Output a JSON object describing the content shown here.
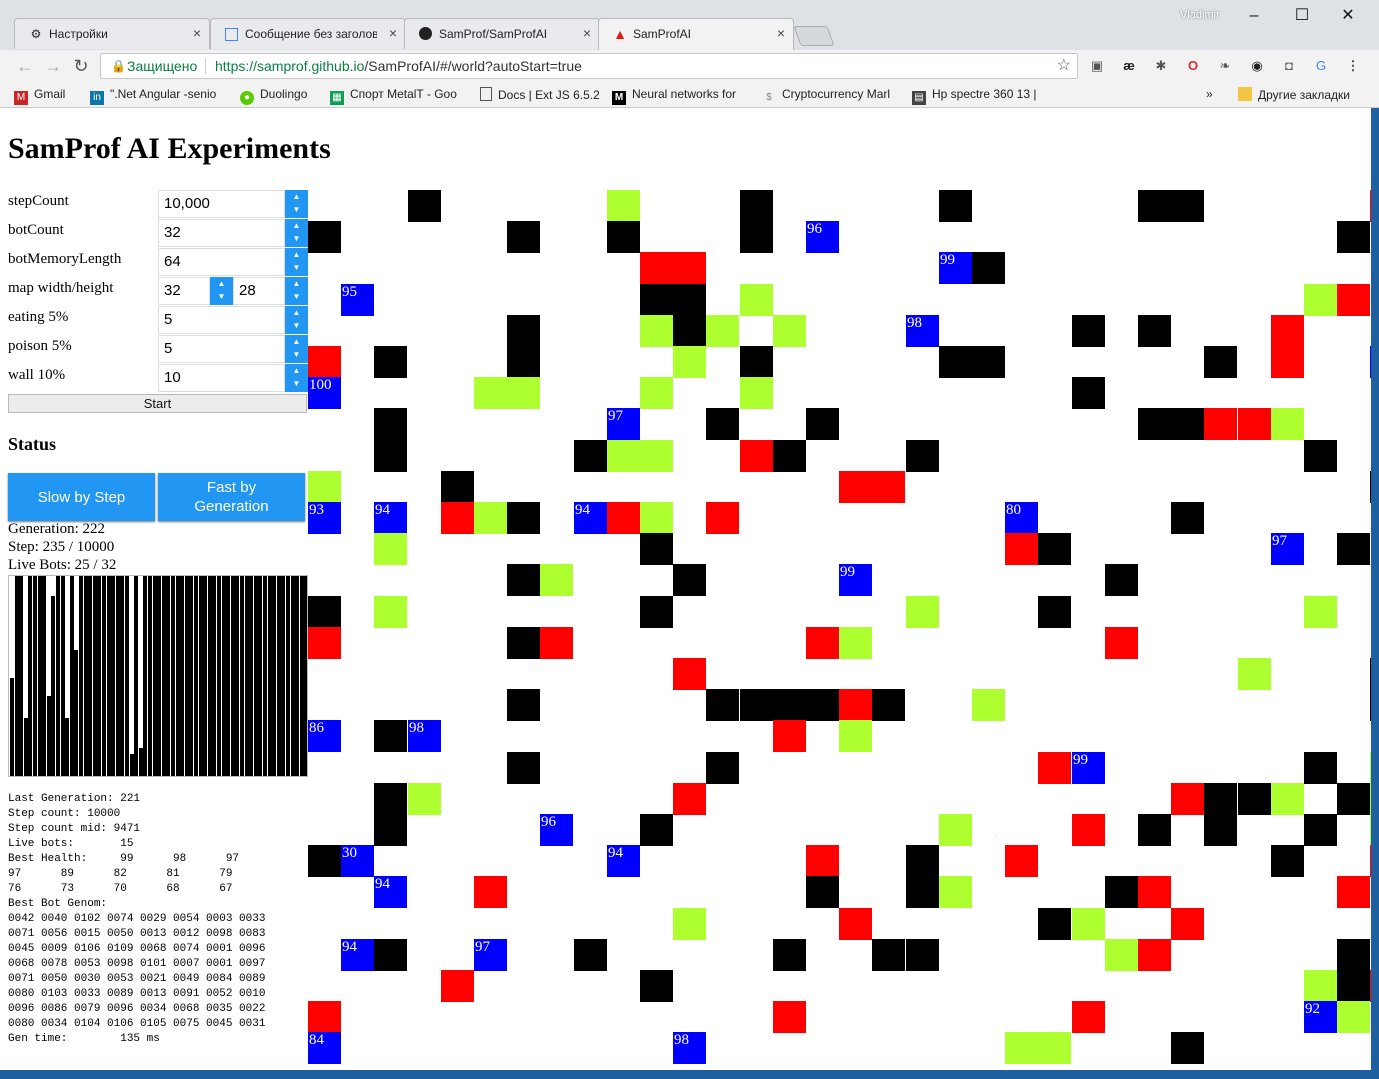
{
  "window": {
    "user": "Vladimir",
    "tabs": [
      {
        "label": "Настройки",
        "icon": "gear-icon"
      },
      {
        "label": "Сообщение без заголов",
        "icon": "doc-icon"
      },
      {
        "label": "SamProf/SamProfAI",
        "icon": "github-icon"
      },
      {
        "label": "SamProfAI",
        "icon": "angular-icon",
        "active": true
      }
    ],
    "close_glyph": "×"
  },
  "toolbar": {
    "secure_label": "Защищено",
    "url_host": "https://samprof.github.io",
    "url_path": "/SamProfAI/#/world?autoStart=true"
  },
  "bookmarks": [
    {
      "label": "Gmail"
    },
    {
      "label": "\".Net Angular -senio"
    },
    {
      "label": "Duolingo"
    },
    {
      "label": "Спорт MetalT - Goo"
    },
    {
      "label": "Docs | Ext JS 6.5.2"
    },
    {
      "label": "Neural networks for"
    },
    {
      "label": "Cryptocurrency Marl"
    },
    {
      "label": "Hp spectre 360 13 |"
    },
    {
      "label": "Другие закладки"
    }
  ],
  "page": {
    "title": "SamProf AI Experiments",
    "fields": [
      {
        "label": "stepCount",
        "value": "10,000"
      },
      {
        "label": "botCount",
        "value": "32"
      },
      {
        "label": "botMemoryLength",
        "value": "64"
      },
      {
        "label": "map width/height",
        "value": "32",
        "value2": "28"
      },
      {
        "label": "eating 5%",
        "value": "5"
      },
      {
        "label": "poison 5%",
        "value": "5"
      },
      {
        "label": "wall 10%",
        "value": "10"
      }
    ],
    "start_label": "Start",
    "status_title": "Status",
    "slow_label": "Slow by Step",
    "fast_label": "Fast by Generation",
    "generation": "Generation: 222",
    "step": "Step: 235 / 10000",
    "live_bots": "Live Bots: 25 / 32",
    "log": "Last Generation: 221\nStep count: 10000\nStep count mid: 9471\nLive bots:       15\nBest Health:     99      98      97\n97      89      82      81      79\n76      73      70      68      67\nBest Bot Genom:\n0042 0040 0102 0074 0029 0054 0003 0033\n0071 0056 0015 0050 0013 0012 0098 0083\n0045 0009 0106 0109 0068 0074 0001 0096\n0068 0078 0053 0098 0101 0007 0001 0097\n0071 0050 0030 0053 0021 0049 0084 0089\n0080 0103 0033 0089 0013 0091 0052 0010\n0096 0086 0079 0096 0034 0068 0035 0022\n0080 0034 0104 0106 0105 0075 0045 0031\nGen time:        135 ms"
  },
  "histogram": [
    0.49,
    1,
    1,
    0.29,
    1,
    1,
    1,
    1,
    0.4,
    0.9,
    1,
    1,
    0.29,
    1,
    0.63,
    1,
    1,
    1,
    1,
    1,
    1,
    1,
    1,
    1,
    1,
    1,
    0.11,
    1,
    0.14,
    1,
    1,
    1,
    1,
    1,
    1,
    1,
    1,
    1,
    1,
    1,
    1,
    1,
    1,
    1,
    1,
    1,
    1,
    1,
    1,
    1,
    1,
    1,
    1,
    1,
    1,
    1,
    1,
    1,
    1,
    1,
    1,
    1,
    1,
    1,
    1
  ],
  "legend": {
    "wall": "#000000",
    "poison": "#ff0000",
    "food": "#adff2f",
    "bot": "#0000ff"
  },
  "world_rows": [
    "...W.....F...W.....W.....WW.....PP",
    "W.....W..W...W.B96...............W",
    "..........PP.......B99W..",
    ".B95........WW.F................FP",
    "......W...FWF.F...B98....W.W...P..",
    "P.W...W....F.W.....WW......W.P..B97",
    "B100....FF...F..F.........W.......",
    "..W......B97..W..W.........WWPPF..",
    "..W.....WFF..PW...W...........W..",
    "F...W...........PP..............WF",
    "B93.B94.PFW.B94PF.P........B80....W..",
    "..F.......W..........PW......B97.W.",
    "......WF...W....B99.......W......",
    "W.F.......W.......F...W.......F...",
    "P.....WP.......PF.......P.........",
    "...........P................F...W.",
    "......W.....WWWWPW..F...........W.",
    "B86.WB98..........P.F.............",
    "......W.....W.........PB99......W.F",
    "..WF.......P..............PWWF.WFF..F",
    "..W....B96..W........F...P.W.W..W.F",
    "WB30.......B94.....P..W..P.......W..P...",
    "..B94..P.........W..WF....WP.....P..",
    "...........F....P.....WF..P......WF",
    ".B94W..B97..W.....W..WW.....FP.....W..",
    "....P.....W...................FWP.....P.W",
    "P.............P........P......B92F.W",
    "B84..........B98.........FF...W.......W."
  ]
}
